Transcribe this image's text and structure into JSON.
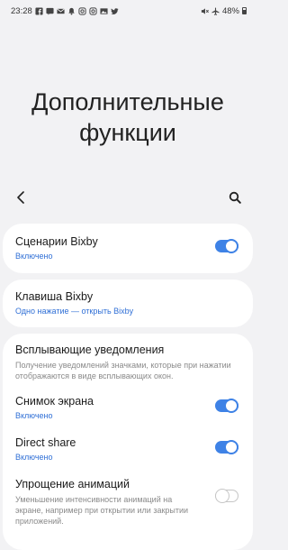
{
  "status_bar": {
    "time": "23:28",
    "battery": "48%",
    "left_icons": [
      "facebook-icon",
      "message-icon",
      "mail-icon",
      "notification-icon",
      "instagram-icon",
      "instagram-icon",
      "image-icon",
      "twitter-icon"
    ],
    "right_icons": [
      "mute-icon",
      "airplane-icon"
    ]
  },
  "header": {
    "title_line1": "Дополнительные",
    "title_line2": "функции"
  },
  "toolbar": {
    "back_icon": "back-arrow-icon",
    "search_icon": "search-icon"
  },
  "items": {
    "bixby_routines": {
      "title": "Сценарии Bixby",
      "subtitle": "Включено",
      "enabled": true
    },
    "bixby_key": {
      "title": "Клавиша Bixby",
      "subtitle": "Одно нажатие — открыть Bixby"
    },
    "popup_notifications": {
      "title": "Всплывающие уведомления",
      "description": "Получение уведомлений значками, которые при нажатии отображаются в виде всплывающих окон."
    },
    "screenshot": {
      "title": "Снимок экрана",
      "subtitle": "Включено",
      "enabled": true
    },
    "direct_share": {
      "title": "Direct share",
      "subtitle": "Включено",
      "enabled": true
    },
    "reduce_animations": {
      "title": "Упрощение анимаций",
      "description": "Уменьшение интенсивности анимаций на экране, например при открытии или закрытии приложений.",
      "enabled": false
    }
  },
  "colors": {
    "accent": "#3e82e6",
    "link_text": "#2f6fd6",
    "background": "#f2f2f4",
    "card": "#ffffff"
  }
}
